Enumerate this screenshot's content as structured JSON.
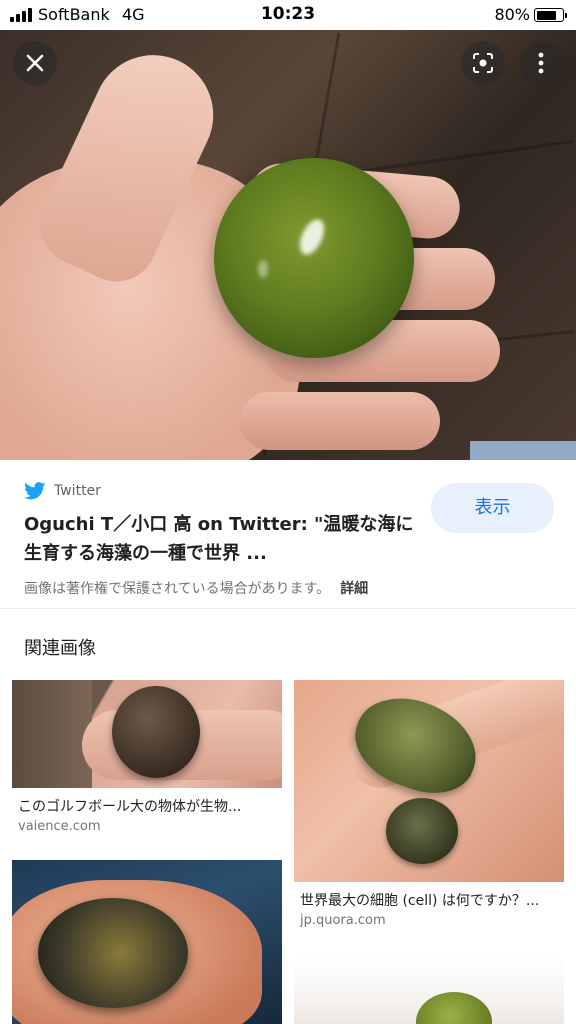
{
  "status_bar": {
    "carrier": "SoftBank",
    "network": "4G",
    "time": "10:23",
    "battery_percent": "80%",
    "battery_level": 0.8
  },
  "viewer": {
    "close_icon": "close-icon",
    "lens_icon": "google-lens-icon",
    "more_icon": "more-vert-icon"
  },
  "source": {
    "site_icon": "twitter-bird-icon",
    "site_name": "Twitter",
    "title": "Oguchi T／小口 高 on Twitter: \"温暖な海に生育する海藻の一種で世界 ...",
    "view_label": "表示",
    "copyright_notice": "画像は著作権で保護されている場合があります。",
    "details_label": "詳細"
  },
  "related": {
    "heading": "関連画像",
    "items": [
      {
        "caption": "このゴルフボール大の物体が生物...",
        "domain": "vaience.com"
      },
      {
        "caption": "世界最大の細胞 (cell) は何ですか？...",
        "domain": "jp.quora.com"
      }
    ]
  },
  "colors": {
    "accent": "#1a73e8",
    "view_button_bg": "#e8f0fe",
    "twitter_blue": "#1da1f2"
  }
}
